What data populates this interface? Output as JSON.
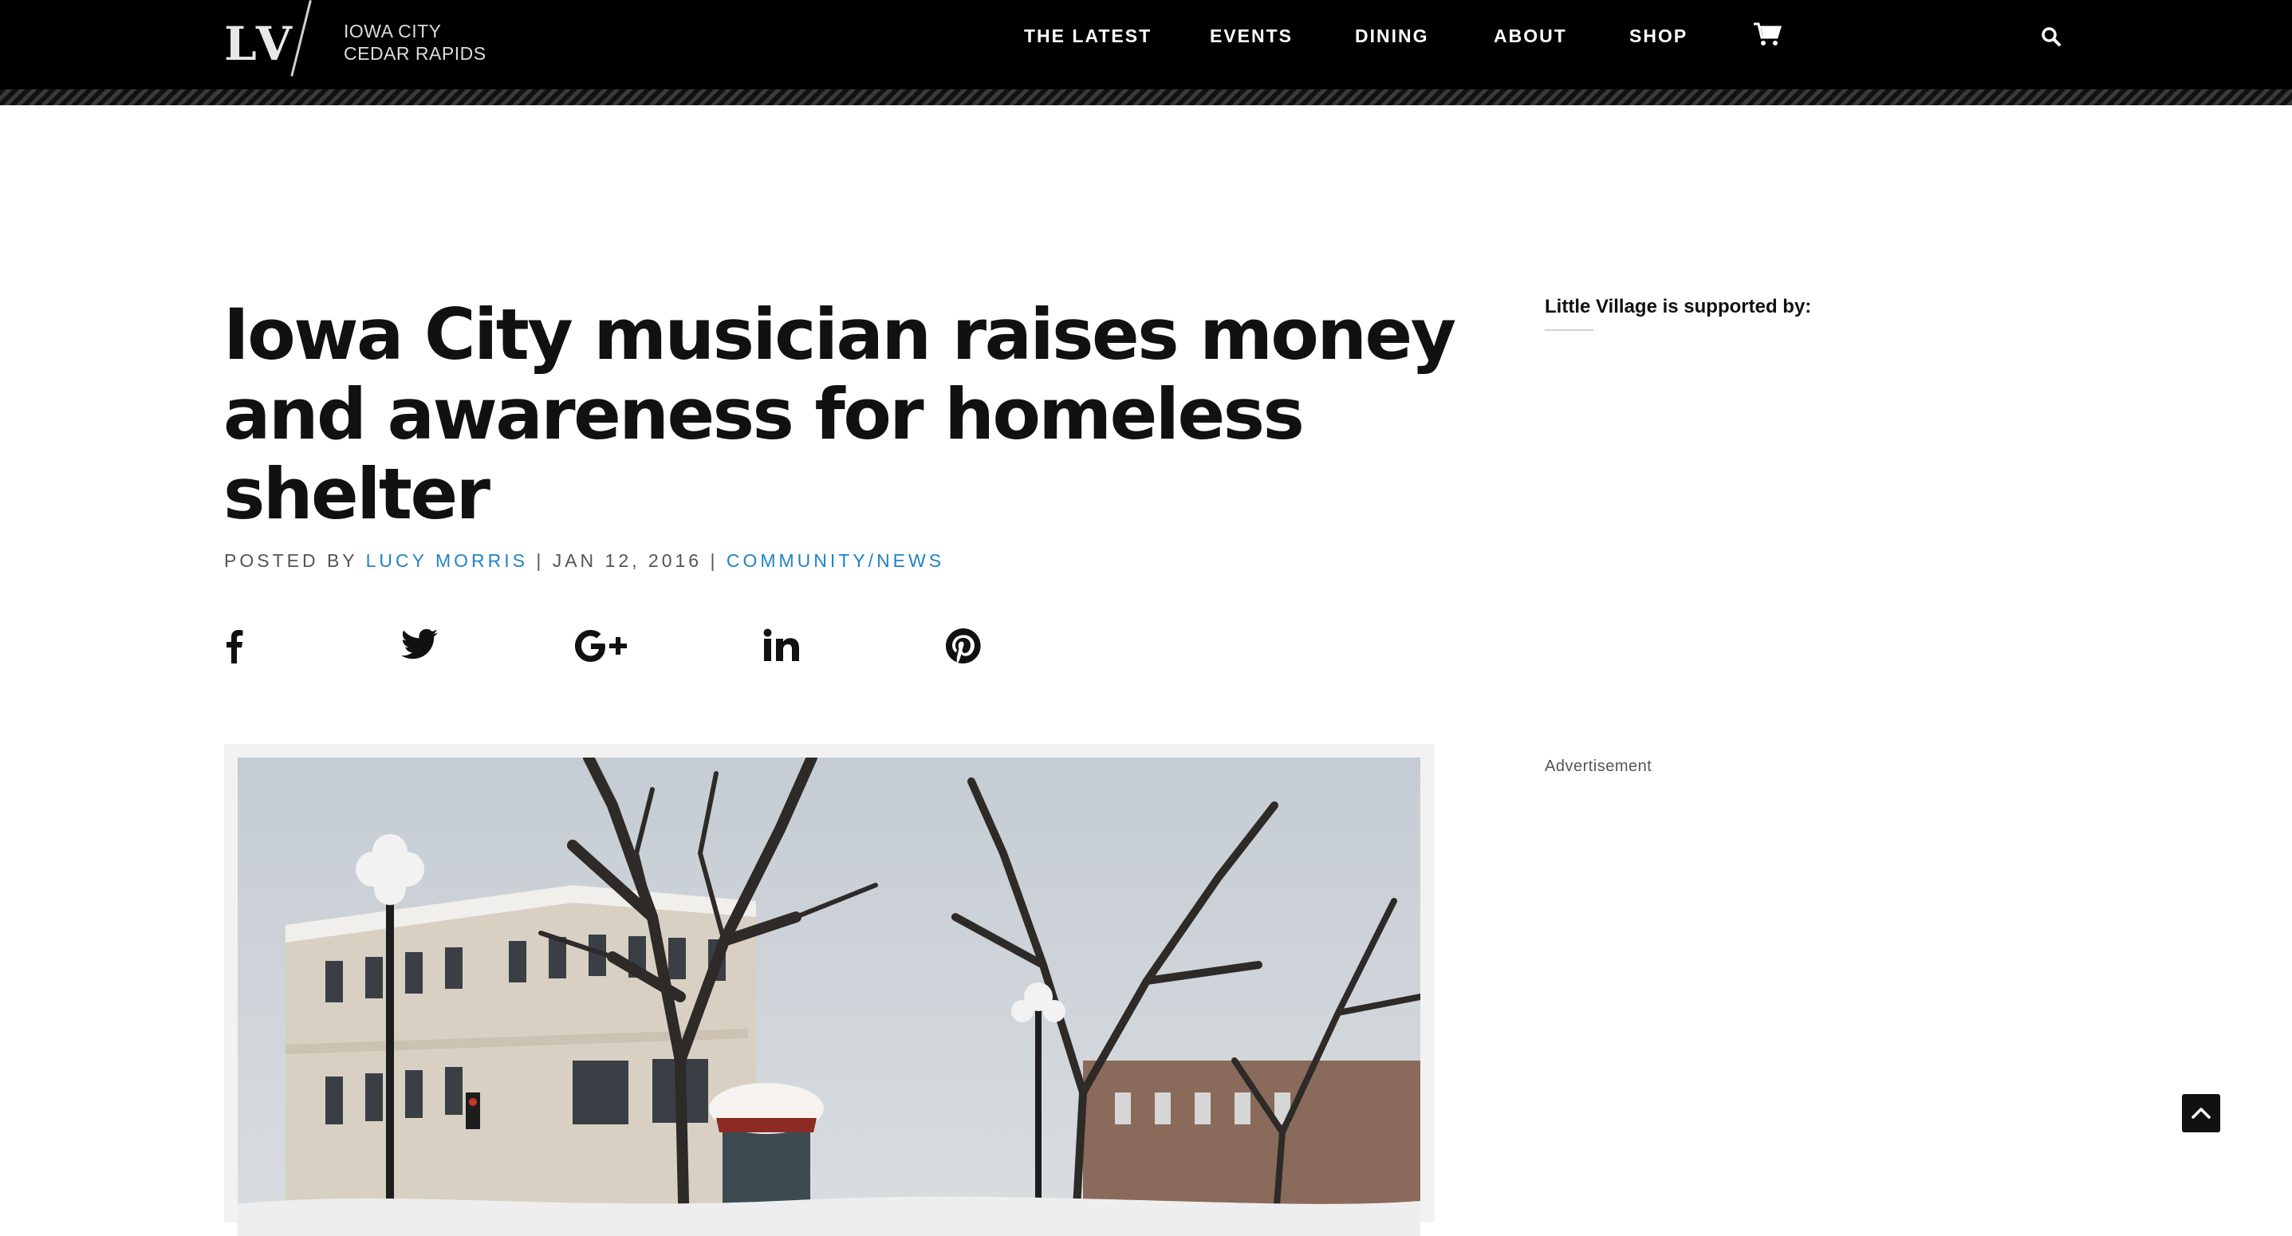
{
  "header": {
    "logo_mark": "LV",
    "logo_line1": "IOWA CITY",
    "logo_line2": "CEDAR RAPIDS",
    "nav": [
      {
        "label": "THE LATEST"
      },
      {
        "label": "EVENTS"
      },
      {
        "label": "DINING"
      },
      {
        "label": "ABOUT"
      },
      {
        "label": "SHOP"
      }
    ],
    "cart_icon": "shopping-cart-icon",
    "search_icon": "search-icon"
  },
  "article": {
    "title": "Iowa City musician raises money and awareness for homeless shelter",
    "posted_by": "POSTED BY",
    "author": "LUCY MORRIS",
    "separator": "|",
    "date": "JAN 12, 2016",
    "category": "COMMUNITY/NEWS",
    "share_icons": [
      "facebook-icon",
      "twitter-icon",
      "google-plus-icon",
      "linkedin-icon",
      "pinterest-icon"
    ]
  },
  "sidebar": {
    "supported_by": "Little Village is supported by:",
    "ad_label": "Advertisement"
  },
  "colors": {
    "nav_bg": "#000000",
    "link": "#1f84c6",
    "headline": "#111111"
  }
}
